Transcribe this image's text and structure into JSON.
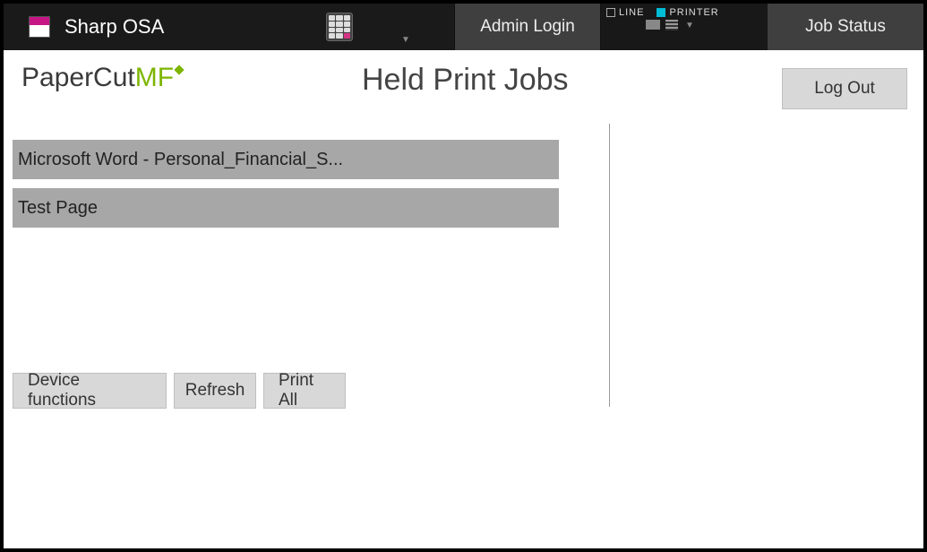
{
  "topbar": {
    "title": "Sharp OSA",
    "admin_login": "Admin Login",
    "status": {
      "line_label": "LINE",
      "printer_label": "PRINTER",
      "line_on": false,
      "printer_on": true
    },
    "job_status": "Job Status"
  },
  "brand": {
    "first": "PaperCut",
    "second": "MF"
  },
  "page_title": "Held Print Jobs",
  "jobs": [
    "Microsoft Word - Personal_Financial_S...",
    "Test Page"
  ],
  "buttons": {
    "device_functions": "Device functions",
    "refresh": "Refresh",
    "print_all": "Print All",
    "logout": "Log Out"
  }
}
